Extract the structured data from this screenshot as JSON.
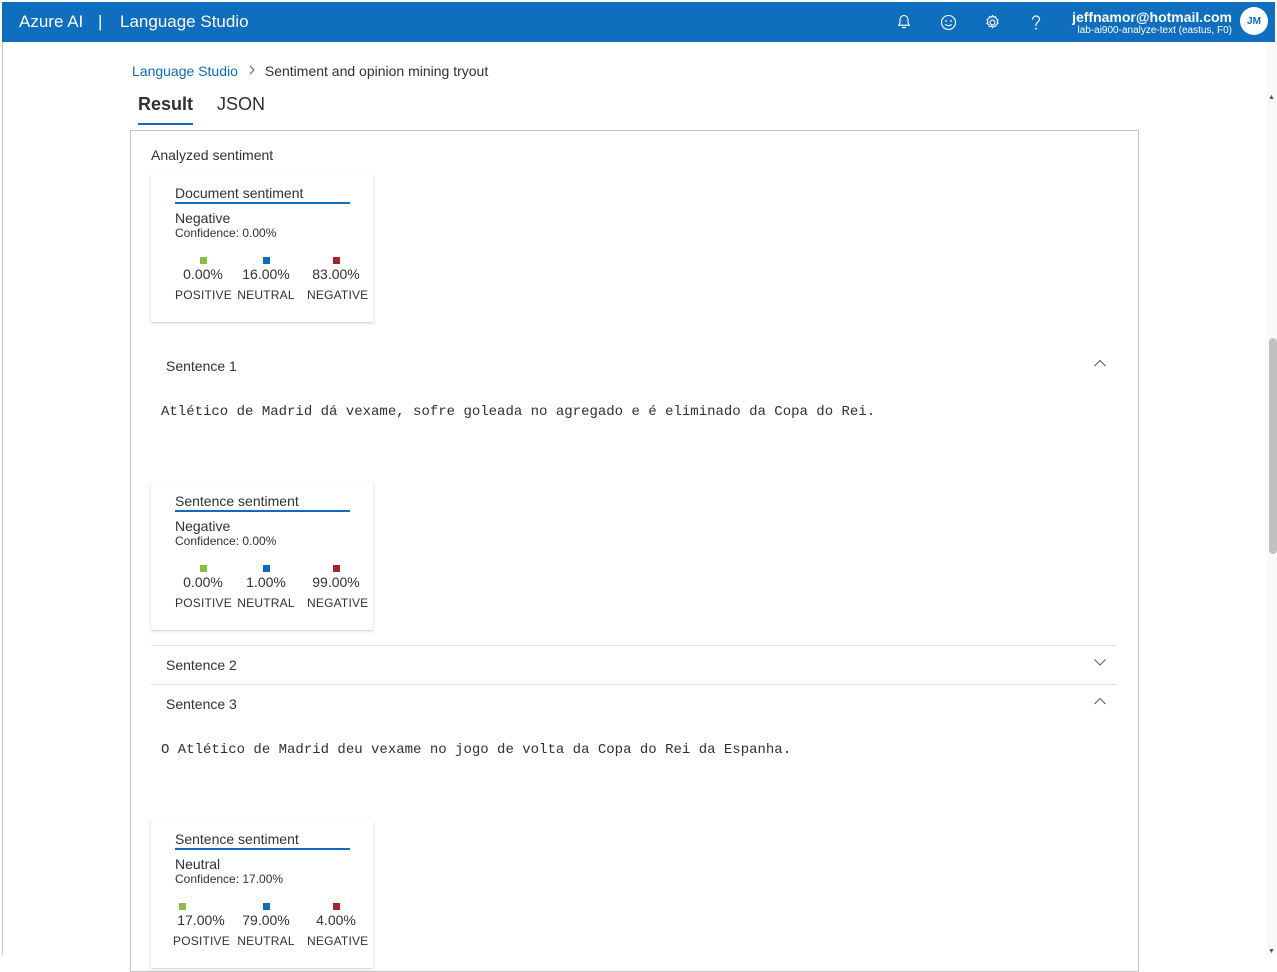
{
  "topbar": {
    "brand": "Azure AI",
    "separator": "|",
    "app_name": "Language Studio",
    "user_email": "jeffnamor@hotmail.com",
    "user_resource": "lab-ai900-analyze-text (eastus, F0)",
    "avatar_initials": "JM",
    "icons": [
      "bell-icon",
      "smiley-icon",
      "gear-icon",
      "help-icon"
    ]
  },
  "breadcrumb": {
    "root": "Language Studio",
    "current": "Sentiment and opinion mining tryout"
  },
  "tabs": [
    {
      "label": "Result",
      "active": true
    },
    {
      "label": "JSON",
      "active": false
    }
  ],
  "panel": {
    "title": "Analyzed sentiment",
    "document_card": {
      "title": "Document sentiment",
      "label": "Negative",
      "confidence": "Confidence: 0.00%",
      "positive": "0.00%",
      "neutral": "16.00%",
      "negative": "83.00%"
    },
    "categories": {
      "positive": "POSITIVE",
      "neutral": "NEUTRAL",
      "negative": "NEGATIVE"
    },
    "sentences": [
      {
        "header": "Sentence 1",
        "expanded": true,
        "text": "Atlético de Madrid dá vexame, sofre goleada no agregado e é eliminado da Copa do Rei.",
        "card": {
          "title": "Sentence sentiment",
          "label": "Negative",
          "confidence": "Confidence: 0.00%",
          "positive": "0.00%",
          "neutral": "1.00%",
          "negative": "99.00%"
        }
      },
      {
        "header": "Sentence 2",
        "expanded": false
      },
      {
        "header": "Sentence 3",
        "expanded": true,
        "text": "O Atlético de Madrid deu vexame no jogo de volta da Copa do Rei da Espanha.",
        "card": {
          "title": "Sentence sentiment",
          "label": "Neutral",
          "confidence": "Confidence: 17.00%",
          "positive": "17.00%",
          "neutral": "79.00%",
          "negative": "4.00%"
        }
      }
    ]
  },
  "colors": {
    "topbar": "#106ebe",
    "link": "#0f6cbd",
    "positive": "#8cbd42",
    "neutral": "#0f6cbd",
    "negative": "#a4262c"
  }
}
